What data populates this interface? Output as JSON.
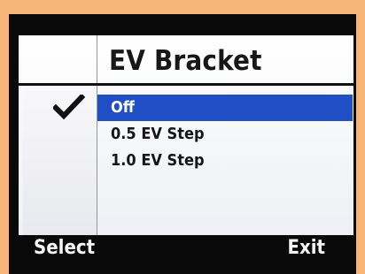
{
  "menu": {
    "title": "EV Bracket",
    "options": [
      {
        "label": "Off",
        "selected": true,
        "checked": true
      },
      {
        "label": "0.5 EV Step",
        "selected": false,
        "checked": false
      },
      {
        "label": "1.0 EV Step",
        "selected": false,
        "checked": false
      }
    ]
  },
  "softkeys": {
    "left": "Select",
    "right": "Exit"
  },
  "colors": {
    "accent": "#1f4fc2",
    "background": "#f7b57a",
    "screen": "#ffffff",
    "text": "#151515"
  },
  "icons": {
    "checkmark": "checkmark-icon"
  }
}
